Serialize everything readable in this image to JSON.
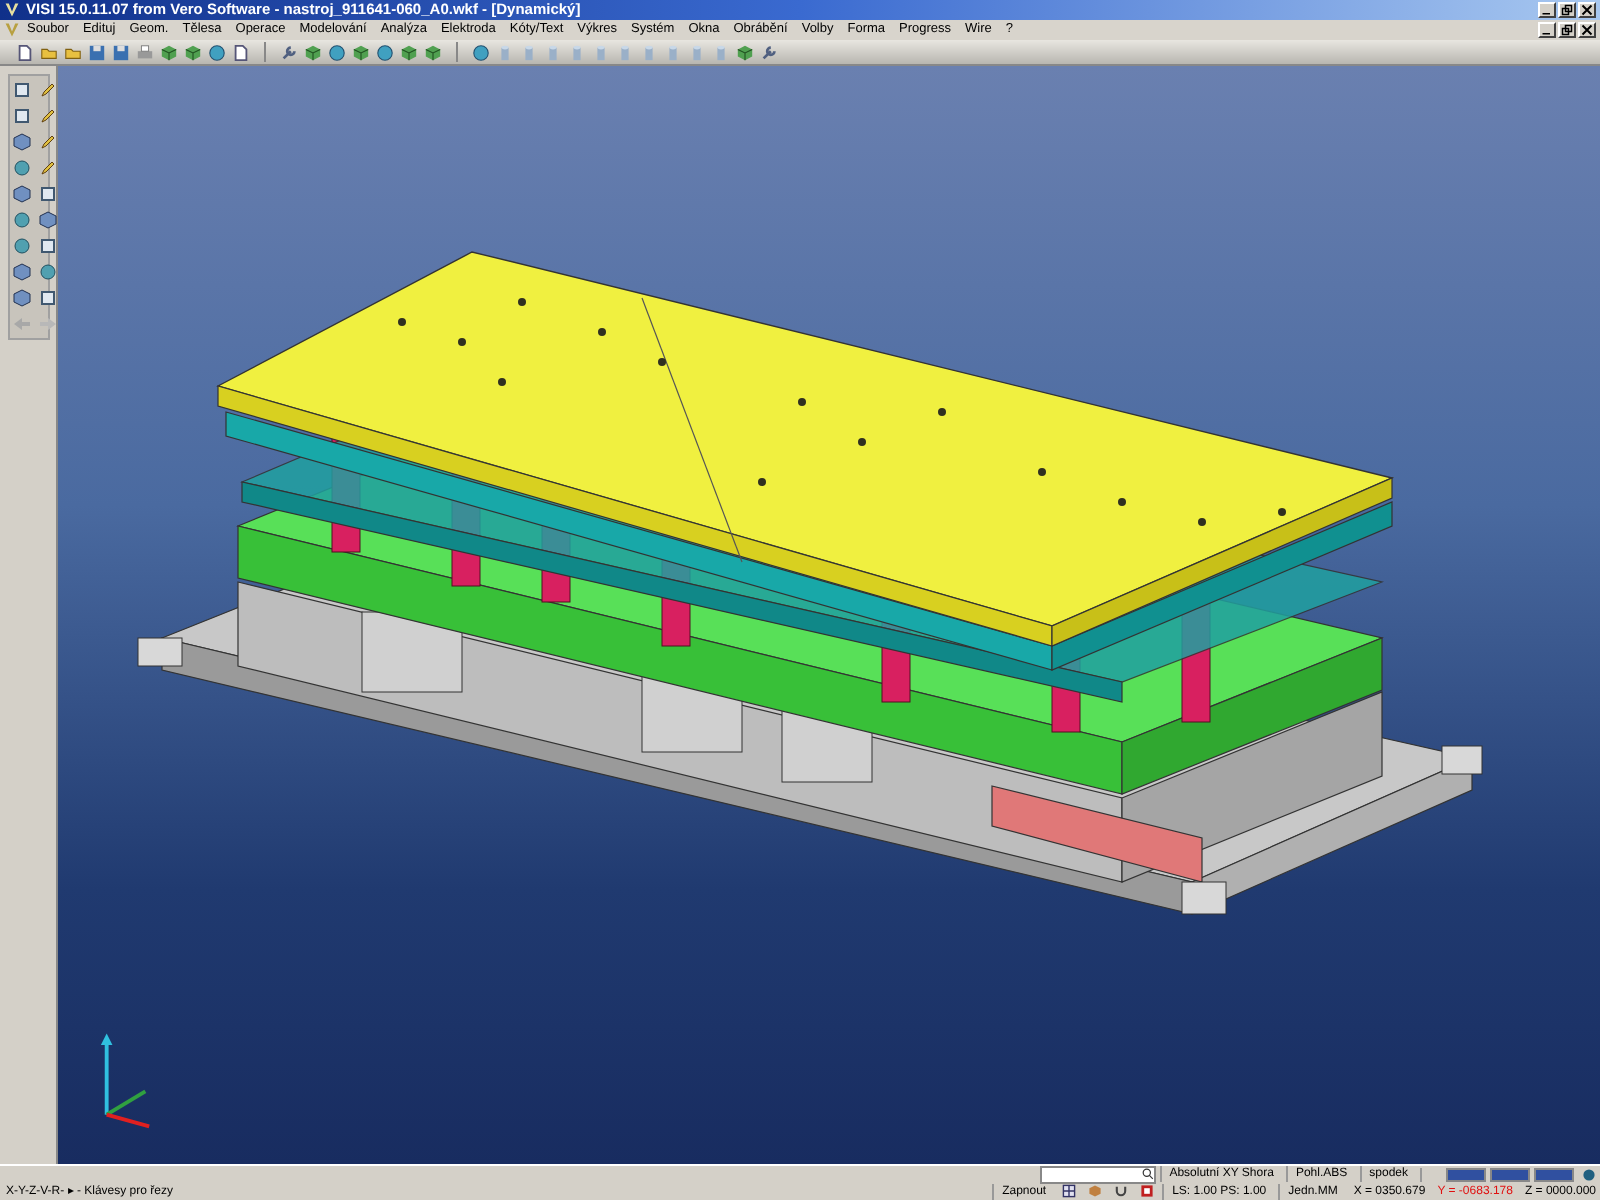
{
  "window": {
    "title": "VISI 15.0.11.07 from Vero Software - nastroj_911641-060_A0.wkf - [Dynamický]"
  },
  "menu": [
    "Soubor",
    "Edituj",
    "Geom.",
    "Tělesa",
    "Operace",
    "Modelování",
    "Analýza",
    "Elektroda",
    "Kóty/Text",
    "Výkres",
    "Systém",
    "Okna",
    "Obrábění",
    "Volby",
    "Forma",
    "Progress",
    "Wire",
    "?"
  ],
  "status_bar": {
    "view_fields": [
      "Absolutní XY Shora",
      "Pohl.ABS",
      "spodek"
    ],
    "hint": "X-Y-Z-V-R- ▸ - Klávesy pro řezy",
    "toggle": "Zapnout",
    "scales": "LS: 1.00 PS: 1.00",
    "units": "Jedn.MM",
    "coords": [
      {
        "text": "X = 0350.679",
        "color": "#000000"
      },
      {
        "text": "Y = -0683.178",
        "color": "#e01010"
      },
      {
        "text": "Z = 0000.000",
        "color": "#000000"
      }
    ]
  }
}
